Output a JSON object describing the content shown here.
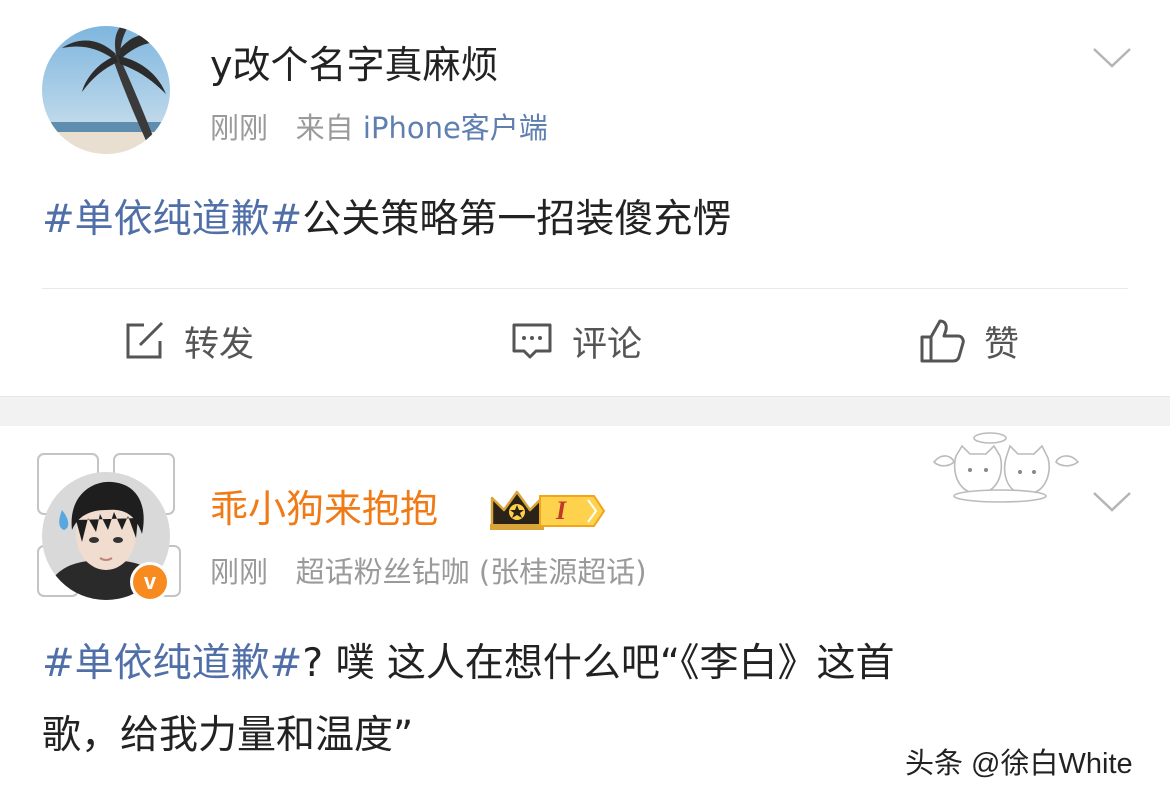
{
  "posts": [
    {
      "username": "y改个名字真麻烦",
      "time": "刚刚",
      "source_prefix": "来自",
      "source": "iPhone客户端",
      "hashtag": "#单依纯道歉#",
      "text": "公关策略第一招装傻充愣",
      "avatar_icon": "palm-beach-avatar"
    },
    {
      "username": "乖小狗来抱抱",
      "time": "刚刚",
      "meta": "超话粉丝钻咖 (张桂源超话)",
      "hashtag": "#单依纯道歉#",
      "text_line1": "? 噗 这人在想什么吧“《李白》这首",
      "text_line2": "歌，给我力量和温度”",
      "level_badge": "I",
      "verified_badge": "v",
      "username_color": "#f07a16"
    }
  ],
  "actions": {
    "repost": "转发",
    "comment": "评论",
    "like": "赞"
  },
  "watermark": "头条 @徐白White",
  "colors": {
    "hashtag": "#506fa8",
    "meta": "#9a9a9a",
    "source": "#5e7fb0"
  }
}
